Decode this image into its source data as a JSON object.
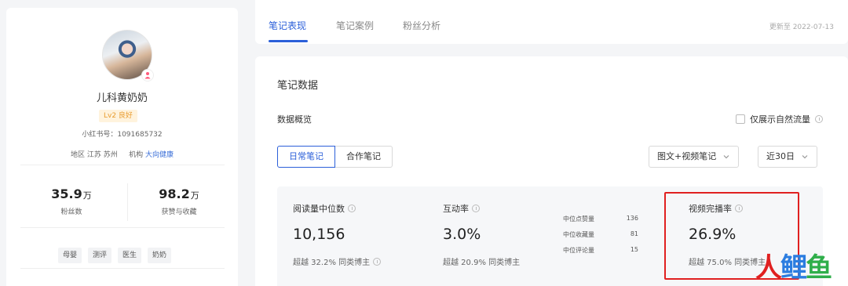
{
  "profile": {
    "name": "儿科黄奶奶",
    "level": "Lv2 良好",
    "account_id": "小红书号：1091685732",
    "region_label": "地区",
    "region_value": "江苏 苏州",
    "org_label": "机构",
    "org_value": "大向健康",
    "stats": [
      {
        "value": "35.9",
        "unit": "万",
        "label": "粉丝数"
      },
      {
        "value": "98.2",
        "unit": "万",
        "label": "获赞与收藏"
      }
    ],
    "tags": [
      "母婴",
      "测评",
      "医生",
      "奶奶"
    ]
  },
  "tabs": [
    {
      "label": "笔记表现",
      "active": true
    },
    {
      "label": "笔记案例",
      "active": false
    },
    {
      "label": "粉丝分析",
      "active": false
    }
  ],
  "update_date": "更新至 2022-07-13",
  "main": {
    "section_title": "笔记数据",
    "subsection_title": "数据概览",
    "natural_traffic_label": "仅展示自然流量",
    "segments": [
      "日常笔记",
      "合作笔记"
    ],
    "type_select": "图文+视频笔记",
    "range_select": "近30日"
  },
  "metrics": [
    {
      "title": "阅读量中位数",
      "value": "10,156",
      "compare": "超越 32.2% 同类博主"
    },
    {
      "title": "互动率",
      "value": "3.0%",
      "compare": "超越 20.9% 同类博主"
    },
    {
      "title": "视频完播率",
      "value": "26.9%",
      "compare": "超越 75.0% 同类博主"
    }
  ],
  "mini_stats": [
    {
      "label": "中位点赞量",
      "value": "136"
    },
    {
      "label": "中位收藏量",
      "value": "81"
    },
    {
      "label": "中位评论量",
      "value": "15"
    }
  ],
  "watermark": [
    "人",
    "鲤",
    "鱼"
  ],
  "colors": {
    "accent": "#2b5fd9",
    "highlight": "#e02020",
    "level_bg": "#fff3dd",
    "level_text": "#e89b2d"
  }
}
